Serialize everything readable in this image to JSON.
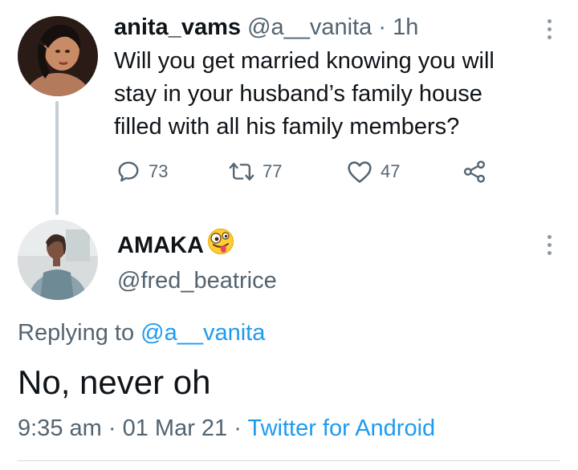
{
  "original_tweet": {
    "display_name": "anita_vams",
    "handle": "@a__vanita",
    "separator": "·",
    "time": "1h",
    "text_lines": [
      "Will you get married knowing you will",
      "stay in your husband’s family house",
      "filled with all his family members?"
    ],
    "actions": {
      "replies": "73",
      "retweets": "77",
      "likes": "47"
    },
    "icons": [
      "reply-icon",
      "retweet-icon",
      "like-icon",
      "share-icon",
      "more-options-icon"
    ]
  },
  "reply_tweet": {
    "display_name": "AMAKA",
    "name_emoji": "zany-face-emoji",
    "handle": "@fred_beatrice",
    "replying_to_label": "Replying to",
    "replying_to_handle": "@a__vanita",
    "text": "No, never oh",
    "time": "9:35 am",
    "separator": "·",
    "date": "01 Mar 21",
    "source": "Twitter for Android",
    "icons": [
      "more-options-icon"
    ]
  },
  "colors": {
    "accent": "#1d9bf0",
    "secondary_text": "#536471",
    "primary_text": "#0f1419",
    "thread_line": "#c4cfd6"
  }
}
